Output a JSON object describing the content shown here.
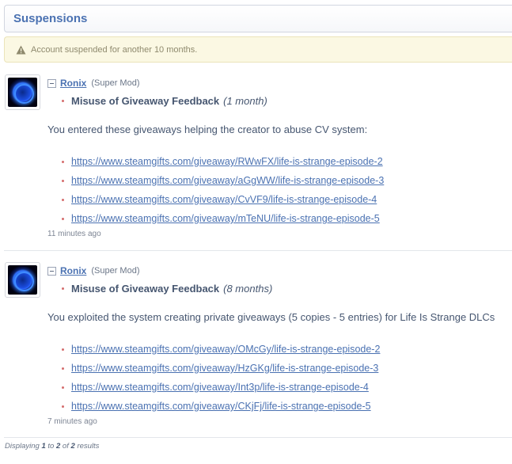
{
  "heading": "Suspensions",
  "notice": {
    "icon": "warning-icon",
    "text": "Account suspended for another 10 months."
  },
  "entries": [
    {
      "author": "Ronix",
      "role": "(Super Mod)",
      "reason": "Misuse of Giveaway Feedback",
      "duration": "(1 month)",
      "description": "You entered these giveaways helping the creator to abuse CV system:",
      "links": [
        "https://www.steamgifts.com/giveaway/RWwFX/life-is-strange-episode-2",
        "https://www.steamgifts.com/giveaway/aGgWW/life-is-strange-episode-3",
        "https://www.steamgifts.com/giveaway/CvVF9/life-is-strange-episode-4",
        "https://www.steamgifts.com/giveaway/mTeNU/life-is-strange-episode-5"
      ],
      "time": "11 minutes ago"
    },
    {
      "author": "Ronix",
      "role": "(Super Mod)",
      "reason": "Misuse of Giveaway Feedback",
      "duration": "(8 months)",
      "description": "You exploited the system creating private giveaways (5 copies - 5 entries) for Life Is Strange DLCs",
      "links": [
        "https://www.steamgifts.com/giveaway/OMcGy/life-is-strange-episode-2",
        "https://www.steamgifts.com/giveaway/HzGKg/life-is-strange-episode-3",
        "https://www.steamgifts.com/giveaway/Int3p/life-is-strange-episode-4",
        "https://www.steamgifts.com/giveaway/CKjFj/life-is-strange-episode-5"
      ],
      "time": "7 minutes ago"
    }
  ],
  "pagination": {
    "prefix": "Displaying",
    "from": "1",
    "to_word": "to",
    "to": "2",
    "of_word": "of",
    "total": "2",
    "suffix": "results"
  },
  "colors": {
    "link": "#4b72b2",
    "notice_bg": "#fbf8e3",
    "bullet": "#d56d6d"
  }
}
